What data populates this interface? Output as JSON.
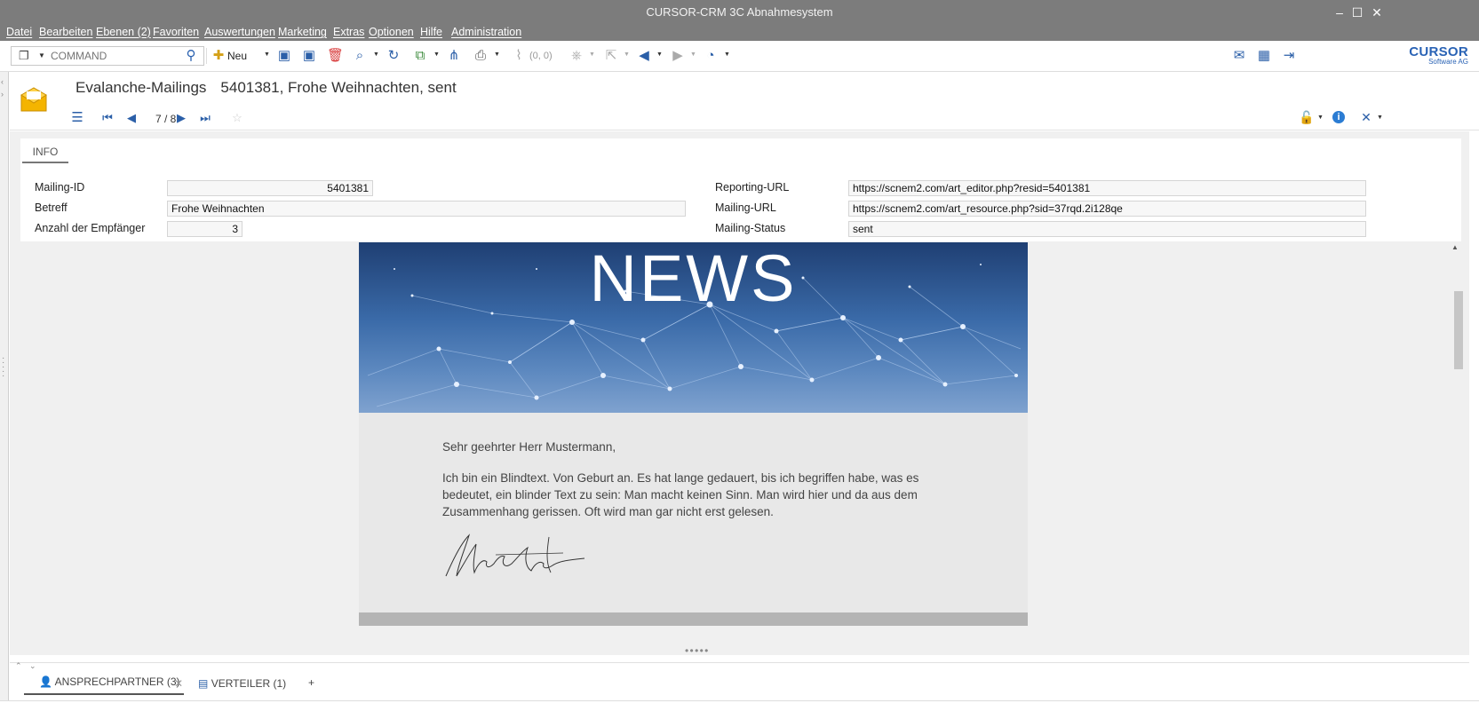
{
  "window": {
    "title": "CURSOR-CRM 3C Abnahmesystem",
    "controls": {
      "minimize": "–",
      "maximize": "☐",
      "close": "✕"
    }
  },
  "menu": [
    "Datei",
    "Bearbeiten",
    "Ebenen (2)",
    "Favoriten",
    "Auswertungen",
    "Marketing",
    "Extras",
    "Optionen",
    "Hilfe",
    "Administration"
  ],
  "toolbar": {
    "command_placeholder": "COMMAND",
    "new_label": "Neu",
    "attachments_label": "(0, 0)",
    "logo_brand": "CURSOR",
    "logo_sub": "Software AG"
  },
  "record": {
    "module": "Evalanche-Mailings",
    "title": "5401381, Frohe Weihnachten, sent",
    "nav_position": "7 / 8"
  },
  "form": {
    "tab_label": "INFO",
    "mailing_id_label": "Mailing-ID",
    "mailing_id": "5401381",
    "subject_label": "Betreff",
    "subject": "Frohe Weihnachten",
    "recipients_label": "Anzahl der Empfänger",
    "recipients": "3",
    "reporting_url_label": "Reporting-URL",
    "reporting_url": "https://scnem2.com/art_editor.php?resid=5401381",
    "mailing_url_label": "Mailing-URL",
    "mailing_url": "https://scnem2.com/art_resource.php?sid=37rqd.2i128qe",
    "status_label": "Mailing-Status",
    "status": "sent"
  },
  "preview": {
    "banner_text": "NEWS",
    "greeting": "Sehr geehrter Herr Mustermann,",
    "body_line1": "Ich bin ein Blindtext. Von Geburt an. Es hat lange gedauert, bis ich begriffen habe, was es",
    "body_line2": "bedeutet, ein blinder Text zu sein: Man macht keinen Sinn. Man wird hier und da aus dem",
    "body_line3": "Zusammenhang gerissen. Oft wird man gar nicht erst gelesen."
  },
  "bottom_tabs": {
    "contacts": "ANSPRECHPARTNER (3)",
    "distribution": "VERTEILER (1)",
    "add": "+"
  },
  "colors": {
    "accent": "#2b5fa8",
    "chrome": "#7c7c7c",
    "delete": "#d83b3b",
    "envelope": "#f4b400"
  }
}
